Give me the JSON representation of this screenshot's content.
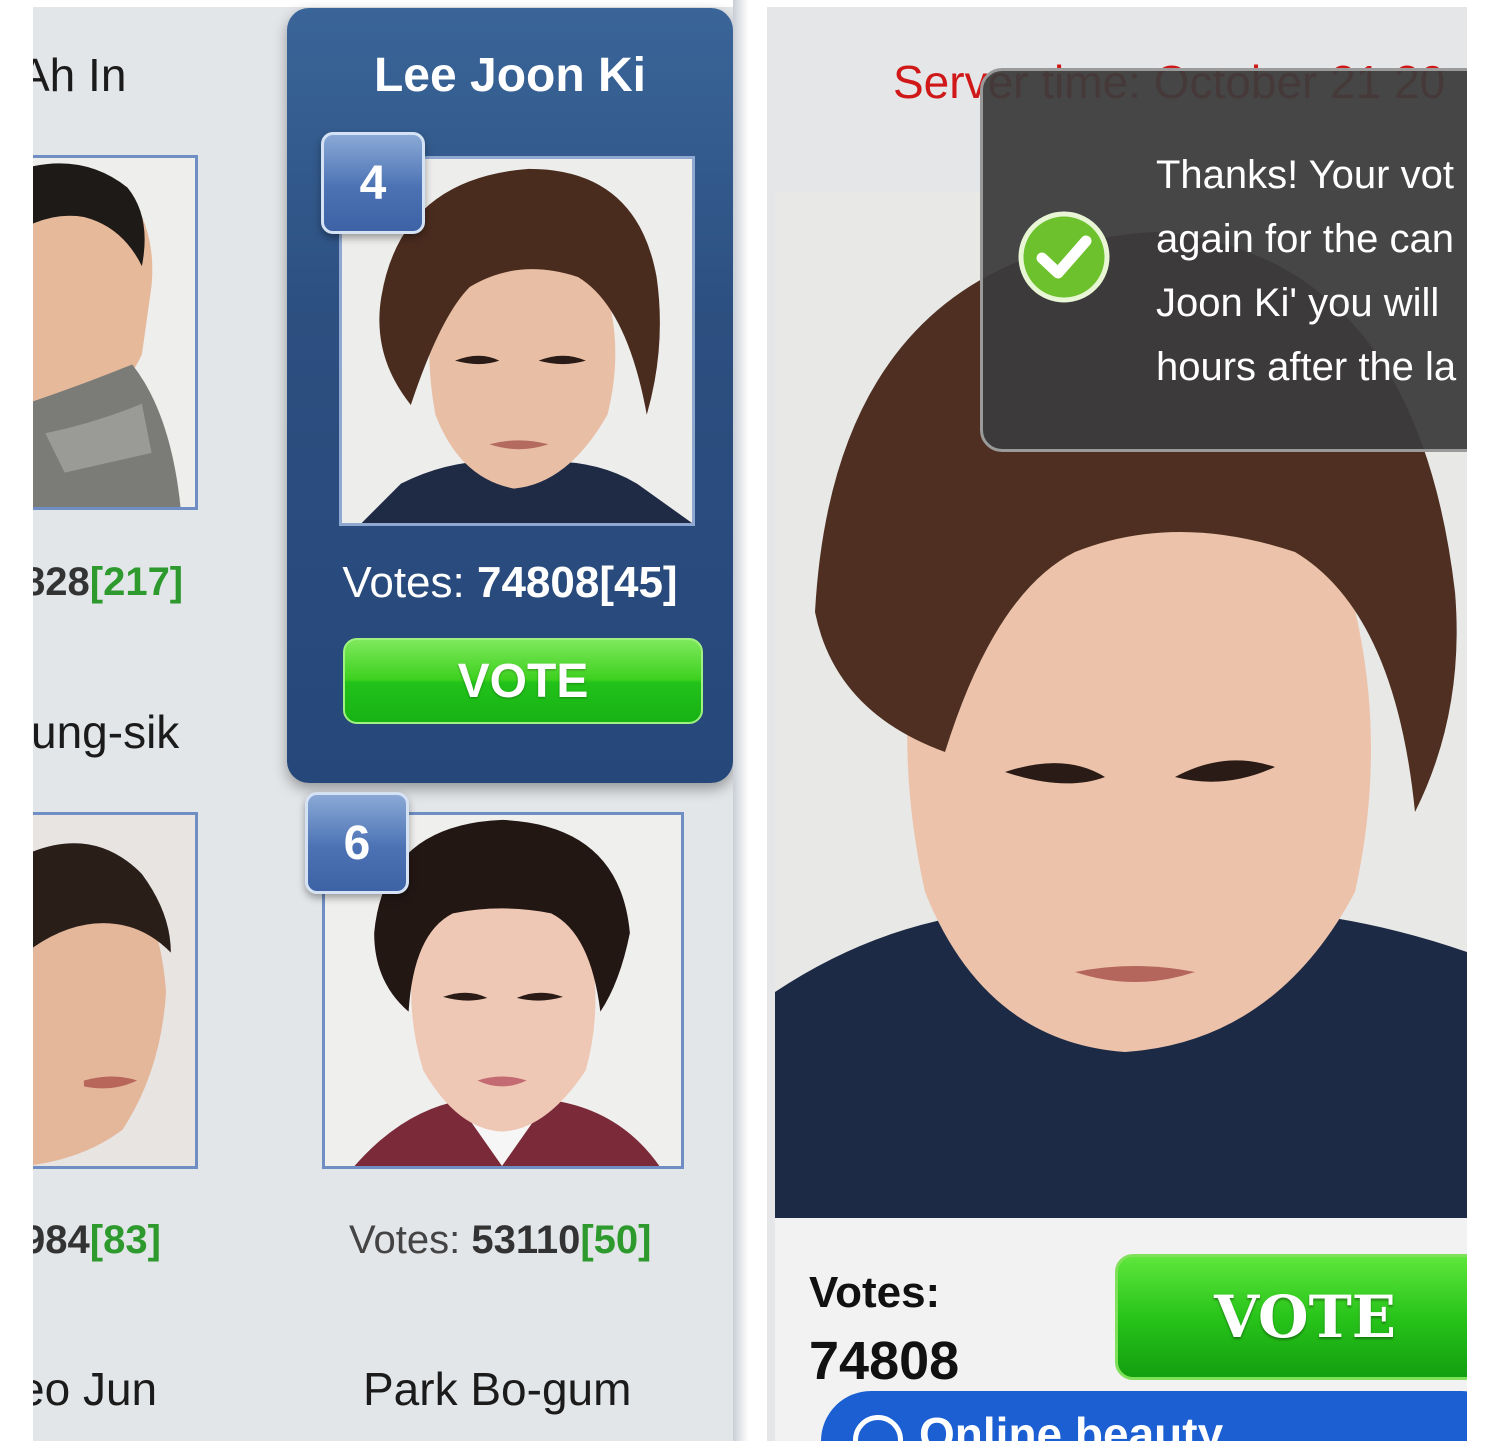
{
  "left": {
    "cards": [
      {
        "name": "Ah In",
        "votes_value": "828",
        "votes_plus": "[217]"
      },
      {
        "name": "ung-sik"
      },
      {
        "name": "",
        "votes_value": "984",
        "votes_plus": "[83]"
      },
      {
        "name": "eo Jun"
      }
    ],
    "featured": {
      "name": "Lee Joon Ki",
      "rank": "4",
      "votes_label": "Votes:",
      "votes_value": "74808[45]",
      "vote_button": "VOTE"
    },
    "card6": {
      "rank": "6",
      "votes_label": "Votes:",
      "votes_value": "53110",
      "votes_plus": "[50]",
      "name": "Park Bo-gum"
    }
  },
  "right": {
    "server_time": "Server time: October 21 20",
    "toast": {
      "text": "Thanks! Your vot\nagain for the can\nJoon Ki' you will\nhours after the la",
      "icon": "check-circle-icon"
    },
    "vote_bar": {
      "votes_label": "Votes:",
      "votes_value": "74808",
      "vote_button": "VOTE"
    },
    "online_button": "Online beauty"
  },
  "colors": {
    "featured_card": "#2c4f80",
    "vote_green": "#22c21a",
    "server_time_red": "#d01818",
    "online_blue": "#1b5fd3",
    "votes_plus_green": "#2e9a2e"
  }
}
